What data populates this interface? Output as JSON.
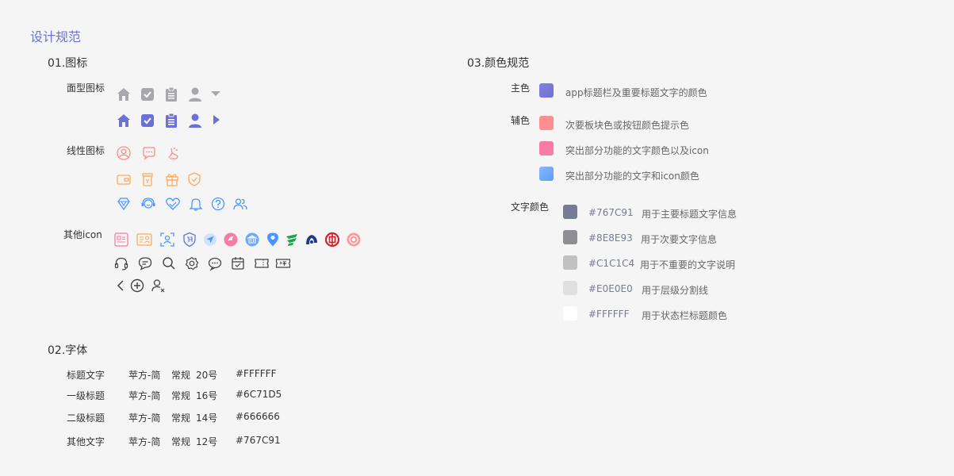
{
  "page_title": "设计规范",
  "icons_section": {
    "title": "01.图标",
    "solid_label": "面型图标",
    "line_label": "线性图标",
    "other_label": "其他icon"
  },
  "font_section": {
    "title": "02.字体",
    "rows": [
      {
        "name": "标题文字",
        "font": "苹方-简",
        "weight": "常规",
        "size": "20号",
        "color": "#FFFFFF"
      },
      {
        "name": "一级标题",
        "font": "苹方-简",
        "weight": "常规",
        "size": "16号",
        "color": "#6C71D5"
      },
      {
        "name": "二级标题",
        "font": "苹方-简",
        "weight": "常规",
        "size": "14号",
        "color": "#666666"
      },
      {
        "name": "其他文字",
        "font": "苹方-简",
        "weight": "常规",
        "size": "12号",
        "color": "#767C91"
      }
    ]
  },
  "color_section": {
    "title": "03.颜色规范",
    "primary_label": "主色",
    "primary_desc": "app标题栏及重要标题文字的颜色",
    "secondary_label": "辅色",
    "secondary": [
      {
        "desc": "次要板块色或按钮颜色提示色"
      },
      {
        "desc": "突出部分功能的文字颜色以及icon"
      },
      {
        "desc": "突出部分功能的文字和icon颜色"
      }
    ],
    "text_label": "文字颜色",
    "text_colors": [
      {
        "hex": "#767C91",
        "desc": "用于主要标题文字信息"
      },
      {
        "hex": "#8E8E93",
        "desc": "用于次要文字信息"
      },
      {
        "hex": "#C1C1C4",
        "desc": "用于不重要的文字说明"
      },
      {
        "hex": "#E0E0E0",
        "desc": "用于层级分割线"
      },
      {
        "hex": "#FFFFFF",
        "desc": "用于状态栏标题颜色"
      }
    ]
  },
  "colors": {
    "accent": "#6c71d5",
    "gray_icon": "#a7a7ad",
    "coral": "#ff8a8a",
    "pink": "#fb7aa6",
    "blue": "#6aa9ff",
    "orange": "#ffaa5c"
  }
}
